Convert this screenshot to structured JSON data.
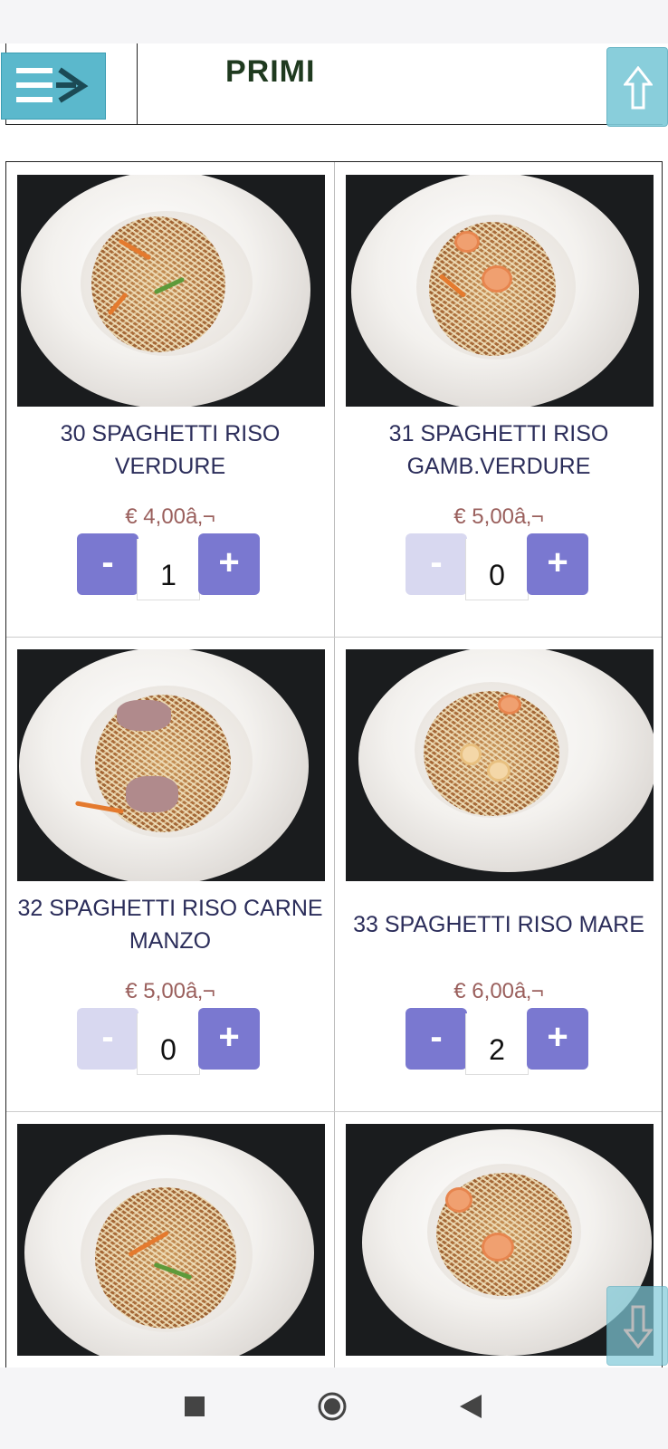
{
  "header": {
    "title": "PRIMI"
  },
  "products": [
    {
      "name": "30 SPAGHETTI RISO VERDURE",
      "price": "€ 4,00â‚¬",
      "quantity": "1",
      "minus_label": "-",
      "plus_label": "+"
    },
    {
      "name": "31 SPAGHETTI RISO GAMB.VERDURE",
      "price": "€ 5,00â‚¬",
      "quantity": "0",
      "minus_label": "-",
      "plus_label": "+"
    },
    {
      "name": "32 SPAGHETTI RISO CARNE MANZO",
      "price": "€ 5,00â‚¬",
      "quantity": "0",
      "minus_label": "-",
      "plus_label": "+"
    },
    {
      "name": "33 SPAGHETTI RISO MARE",
      "price": "€ 6,00â‚¬",
      "quantity": "2",
      "minus_label": "-",
      "plus_label": "+"
    }
  ],
  "colors": {
    "accent": "#7a78d0",
    "accent_disabled": "#d8d8f0",
    "menu_button": "#5bb8cc",
    "price": "#9a5f5c",
    "title": "#1f3a1f"
  },
  "icons": {
    "menu": "menu-arrow-icon",
    "scroll_up": "arrow-up-icon",
    "scroll_down": "arrow-down-icon",
    "nav_recents": "square-icon",
    "nav_home": "circle-icon",
    "nav_back": "triangle-back-icon"
  }
}
